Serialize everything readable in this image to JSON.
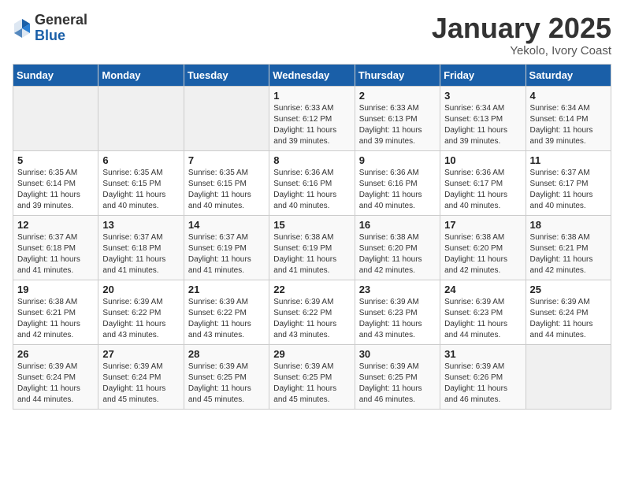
{
  "header": {
    "logo_general": "General",
    "logo_blue": "Blue",
    "month_title": "January 2025",
    "location": "Yekolo, Ivory Coast"
  },
  "weekdays": [
    "Sunday",
    "Monday",
    "Tuesday",
    "Wednesday",
    "Thursday",
    "Friday",
    "Saturday"
  ],
  "weeks": [
    [
      {
        "day": "",
        "info": ""
      },
      {
        "day": "",
        "info": ""
      },
      {
        "day": "",
        "info": ""
      },
      {
        "day": "1",
        "info": "Sunrise: 6:33 AM\nSunset: 6:12 PM\nDaylight: 11 hours\nand 39 minutes."
      },
      {
        "day": "2",
        "info": "Sunrise: 6:33 AM\nSunset: 6:13 PM\nDaylight: 11 hours\nand 39 minutes."
      },
      {
        "day": "3",
        "info": "Sunrise: 6:34 AM\nSunset: 6:13 PM\nDaylight: 11 hours\nand 39 minutes."
      },
      {
        "day": "4",
        "info": "Sunrise: 6:34 AM\nSunset: 6:14 PM\nDaylight: 11 hours\nand 39 minutes."
      }
    ],
    [
      {
        "day": "5",
        "info": "Sunrise: 6:35 AM\nSunset: 6:14 PM\nDaylight: 11 hours\nand 39 minutes."
      },
      {
        "day": "6",
        "info": "Sunrise: 6:35 AM\nSunset: 6:15 PM\nDaylight: 11 hours\nand 40 minutes."
      },
      {
        "day": "7",
        "info": "Sunrise: 6:35 AM\nSunset: 6:15 PM\nDaylight: 11 hours\nand 40 minutes."
      },
      {
        "day": "8",
        "info": "Sunrise: 6:36 AM\nSunset: 6:16 PM\nDaylight: 11 hours\nand 40 minutes."
      },
      {
        "day": "9",
        "info": "Sunrise: 6:36 AM\nSunset: 6:16 PM\nDaylight: 11 hours\nand 40 minutes."
      },
      {
        "day": "10",
        "info": "Sunrise: 6:36 AM\nSunset: 6:17 PM\nDaylight: 11 hours\nand 40 minutes."
      },
      {
        "day": "11",
        "info": "Sunrise: 6:37 AM\nSunset: 6:17 PM\nDaylight: 11 hours\nand 40 minutes."
      }
    ],
    [
      {
        "day": "12",
        "info": "Sunrise: 6:37 AM\nSunset: 6:18 PM\nDaylight: 11 hours\nand 41 minutes."
      },
      {
        "day": "13",
        "info": "Sunrise: 6:37 AM\nSunset: 6:18 PM\nDaylight: 11 hours\nand 41 minutes."
      },
      {
        "day": "14",
        "info": "Sunrise: 6:37 AM\nSunset: 6:19 PM\nDaylight: 11 hours\nand 41 minutes."
      },
      {
        "day": "15",
        "info": "Sunrise: 6:38 AM\nSunset: 6:19 PM\nDaylight: 11 hours\nand 41 minutes."
      },
      {
        "day": "16",
        "info": "Sunrise: 6:38 AM\nSunset: 6:20 PM\nDaylight: 11 hours\nand 42 minutes."
      },
      {
        "day": "17",
        "info": "Sunrise: 6:38 AM\nSunset: 6:20 PM\nDaylight: 11 hours\nand 42 minutes."
      },
      {
        "day": "18",
        "info": "Sunrise: 6:38 AM\nSunset: 6:21 PM\nDaylight: 11 hours\nand 42 minutes."
      }
    ],
    [
      {
        "day": "19",
        "info": "Sunrise: 6:38 AM\nSunset: 6:21 PM\nDaylight: 11 hours\nand 42 minutes."
      },
      {
        "day": "20",
        "info": "Sunrise: 6:39 AM\nSunset: 6:22 PM\nDaylight: 11 hours\nand 43 minutes."
      },
      {
        "day": "21",
        "info": "Sunrise: 6:39 AM\nSunset: 6:22 PM\nDaylight: 11 hours\nand 43 minutes."
      },
      {
        "day": "22",
        "info": "Sunrise: 6:39 AM\nSunset: 6:22 PM\nDaylight: 11 hours\nand 43 minutes."
      },
      {
        "day": "23",
        "info": "Sunrise: 6:39 AM\nSunset: 6:23 PM\nDaylight: 11 hours\nand 43 minutes."
      },
      {
        "day": "24",
        "info": "Sunrise: 6:39 AM\nSunset: 6:23 PM\nDaylight: 11 hours\nand 44 minutes."
      },
      {
        "day": "25",
        "info": "Sunrise: 6:39 AM\nSunset: 6:24 PM\nDaylight: 11 hours\nand 44 minutes."
      }
    ],
    [
      {
        "day": "26",
        "info": "Sunrise: 6:39 AM\nSunset: 6:24 PM\nDaylight: 11 hours\nand 44 minutes."
      },
      {
        "day": "27",
        "info": "Sunrise: 6:39 AM\nSunset: 6:24 PM\nDaylight: 11 hours\nand 45 minutes."
      },
      {
        "day": "28",
        "info": "Sunrise: 6:39 AM\nSunset: 6:25 PM\nDaylight: 11 hours\nand 45 minutes."
      },
      {
        "day": "29",
        "info": "Sunrise: 6:39 AM\nSunset: 6:25 PM\nDaylight: 11 hours\nand 45 minutes."
      },
      {
        "day": "30",
        "info": "Sunrise: 6:39 AM\nSunset: 6:25 PM\nDaylight: 11 hours\nand 46 minutes."
      },
      {
        "day": "31",
        "info": "Sunrise: 6:39 AM\nSunset: 6:26 PM\nDaylight: 11 hours\nand 46 minutes."
      },
      {
        "day": "",
        "info": ""
      }
    ]
  ]
}
